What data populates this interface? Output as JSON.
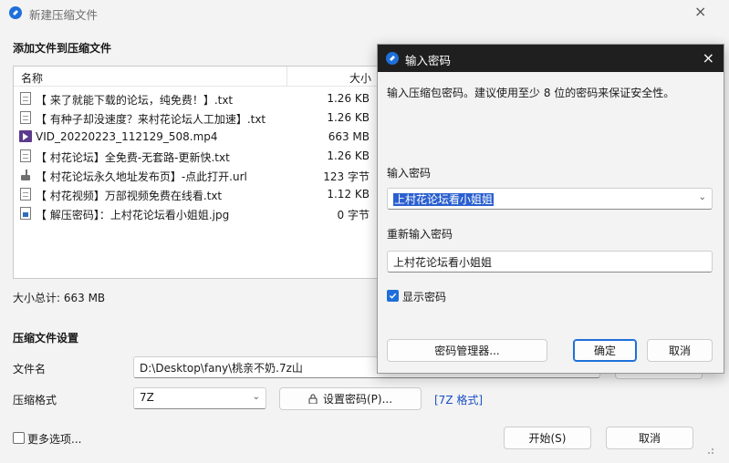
{
  "window": {
    "title": "新建压缩文件",
    "close": "×"
  },
  "files_section": {
    "title": "添加文件到压缩文件",
    "columns": {
      "name": "名称",
      "size": "大小"
    },
    "files": [
      {
        "name": "【 来了就能下载的论坛，纯免费！】.txt",
        "size": "1.26 KB",
        "type": "txt"
      },
      {
        "name": "【 有种子却没速度？来村花论坛人工加速】.txt",
        "size": "1.26 KB",
        "type": "txt"
      },
      {
        "name": "VID_20220223_112129_508.mp4",
        "size": "663 MB",
        "type": "mp4"
      },
      {
        "name": "【 村花论坛】全免费-无套路-更新快.txt",
        "size": "1.26 KB",
        "type": "txt"
      },
      {
        "name": "【 村花论坛永久地址发布页】-点此打开.url",
        "size": "123 字节",
        "type": "url"
      },
      {
        "name": "【 村花视频】万部视频免费在线看.txt",
        "size": "1.12 KB",
        "type": "txt"
      },
      {
        "name": "【 解压密码】：上村花论坛看小姐姐.jpg",
        "size": "0 字节",
        "type": "jpg"
      }
    ],
    "total_label": "大小总计: 663 MB"
  },
  "settings": {
    "title": "压缩文件设置",
    "filename_label": "文件名",
    "filename_value": "D:\\Desktop\\fany\\桃亲不奶.7z山",
    "format_label": "压缩格式",
    "format_value": "7Z",
    "set_password_button": "设置密码(P)...",
    "format_link": "[7Z 格式]"
  },
  "footer": {
    "more_options": "更多选项...",
    "start_button": "开始(S)",
    "cancel_button": "取消"
  },
  "password_dialog": {
    "title": "输入密码",
    "close": "×",
    "description": "输入压缩包密码。建议使用至少 8 位的密码来保证安全性。",
    "password_label": "输入密码",
    "password_value": "上村花论坛看小姐姐",
    "confirm_label": "重新输入密码",
    "confirm_value": "上村花论坛看小姐姐",
    "show_password_label": "显示密码",
    "show_password_checked": true,
    "manager_button": "密码管理器...",
    "ok_button": "确定",
    "cancel_button": "取消"
  },
  "colors": {
    "accent": "#1e6fd9",
    "dialog_titlebar": "#1f1f1f",
    "selection": "#2a5fcf"
  }
}
